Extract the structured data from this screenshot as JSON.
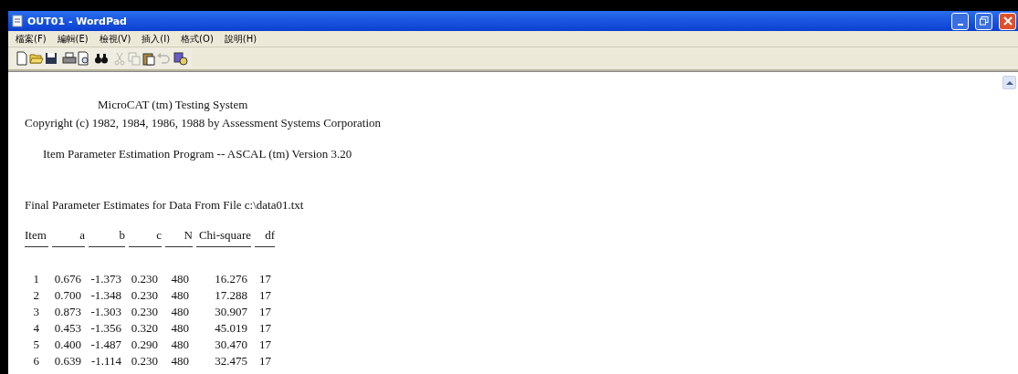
{
  "window": {
    "title": "OUT01 - WordPad"
  },
  "menu": [
    {
      "label": "檔案(F)"
    },
    {
      "label": "編輯(E)"
    },
    {
      "label": "檢視(V)"
    },
    {
      "label": "插入(I)"
    },
    {
      "label": "格式(O)"
    },
    {
      "label": "說明(H)"
    }
  ],
  "toolbar": [
    {
      "kind": "new",
      "disabled": false
    },
    {
      "kind": "open",
      "disabled": false
    },
    {
      "kind": "save",
      "disabled": false
    },
    {
      "kind": "sep"
    },
    {
      "kind": "print",
      "disabled": false
    },
    {
      "kind": "preview",
      "disabled": false
    },
    {
      "kind": "sep"
    },
    {
      "kind": "find",
      "disabled": false
    },
    {
      "kind": "sep"
    },
    {
      "kind": "cut",
      "disabled": true
    },
    {
      "kind": "copy",
      "disabled": true
    },
    {
      "kind": "paste",
      "disabled": false
    },
    {
      "kind": "undo",
      "disabled": true
    },
    {
      "kind": "sep"
    },
    {
      "kind": "datetime",
      "disabled": false
    }
  ],
  "document": {
    "lines": [
      {
        "text": "MicroCAT (tm) Testing System"
      },
      {
        "text": "Copyright (c) 1982, 1984, 1986, 1988 by Assessment Systems Corporation"
      },
      {
        "text": "Item Parameter Estimation Program -- ASCAL (tm) Version 3.20"
      },
      {
        "text": "Final Parameter Estimates for Data From File c:\\data01.txt"
      }
    ],
    "table": {
      "columns": [
        "Item",
        "a",
        "b",
        "c",
        "N",
        "Chi-square",
        "df"
      ],
      "rows": [
        [
          "1",
          "0.676",
          "-1.373",
          "0.230",
          "480",
          "16.276",
          "17"
        ],
        [
          "2",
          "0.700",
          "-1.348",
          "0.230",
          "480",
          "17.288",
          "17"
        ],
        [
          "3",
          "0.873",
          "-1.303",
          "0.230",
          "480",
          "30.907",
          "17"
        ],
        [
          "4",
          "0.453",
          "-1.356",
          "0.320",
          "480",
          "45.019",
          "17"
        ],
        [
          "5",
          "0.400",
          "-1.487",
          "0.290",
          "480",
          "30.470",
          "17"
        ],
        [
          "6",
          "0.639",
          "-1.114",
          "0.230",
          "480",
          "32.475",
          "17"
        ]
      ]
    }
  }
}
